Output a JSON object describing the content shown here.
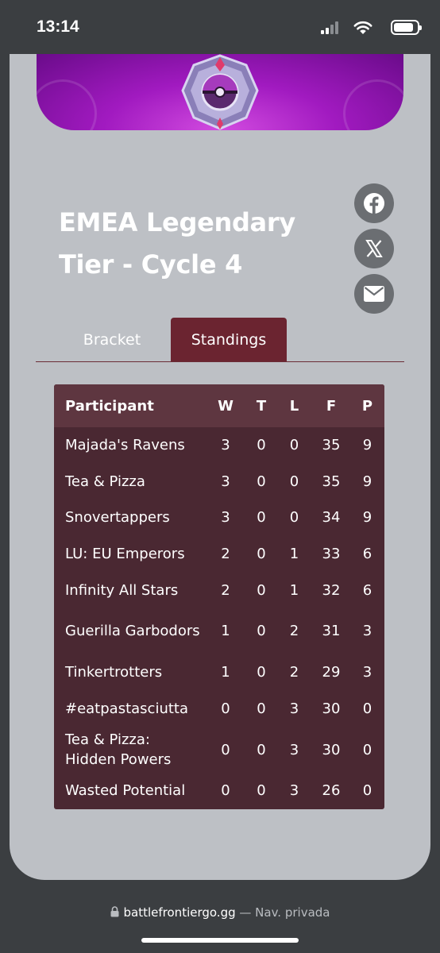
{
  "status_bar": {
    "time": "13:14"
  },
  "page": {
    "title": "EMEA Legendary Tier - Cycle 4",
    "title_lines": [
      "EMEA Legendary",
      "Tier - Cycle 4"
    ]
  },
  "share": [
    {
      "icon": "facebook-icon"
    },
    {
      "icon": "x-icon"
    },
    {
      "icon": "mail-icon"
    }
  ],
  "tabs": [
    {
      "label": "Bracket",
      "active": false
    },
    {
      "label": "Standings",
      "active": true
    }
  ],
  "table": {
    "columns": [
      "Participant",
      "W",
      "T",
      "L",
      "F",
      "P"
    ],
    "rows": [
      {
        "name": "Majada's Ravens",
        "w": "3",
        "t": "0",
        "l": "0",
        "f": "35",
        "p": "9"
      },
      {
        "name": "Tea & Pizza",
        "w": "3",
        "t": "0",
        "l": "0",
        "f": "35",
        "p": "9"
      },
      {
        "name": "Snovertappers",
        "w": "3",
        "t": "0",
        "l": "0",
        "f": "34",
        "p": "9"
      },
      {
        "name": "LU: EU Emperors",
        "w": "2",
        "t": "0",
        "l": "1",
        "f": "33",
        "p": "6"
      },
      {
        "name": "Infinity All Stars",
        "w": "2",
        "t": "0",
        "l": "1",
        "f": "32",
        "p": "6"
      },
      {
        "name": "Guerilla Garbodors",
        "w": "1",
        "t": "0",
        "l": "2",
        "f": "31",
        "p": "3"
      },
      {
        "name": "Tinkertrotters",
        "w": "1",
        "t": "0",
        "l": "2",
        "f": "29",
        "p": "3"
      },
      {
        "name": "#eatpastasciutta",
        "w": "0",
        "t": "0",
        "l": "3",
        "f": "30",
        "p": "0"
      },
      {
        "name": "Tea & Pizza: Hidden Powers",
        "w": "0",
        "t": "0",
        "l": "3",
        "f": "30",
        "p": "0"
      },
      {
        "name": "Wasted Potential",
        "w": "0",
        "t": "0",
        "l": "3",
        "f": "26",
        "p": "0"
      }
    ]
  },
  "browser": {
    "url": "battlefrontiergo.gg",
    "mode": "— Nav. privada"
  },
  "colors": {
    "page_bg": "#bdc0c5",
    "accent": "#6b2430",
    "table_bg": "#4a2832",
    "banner": "#a11ac0"
  }
}
